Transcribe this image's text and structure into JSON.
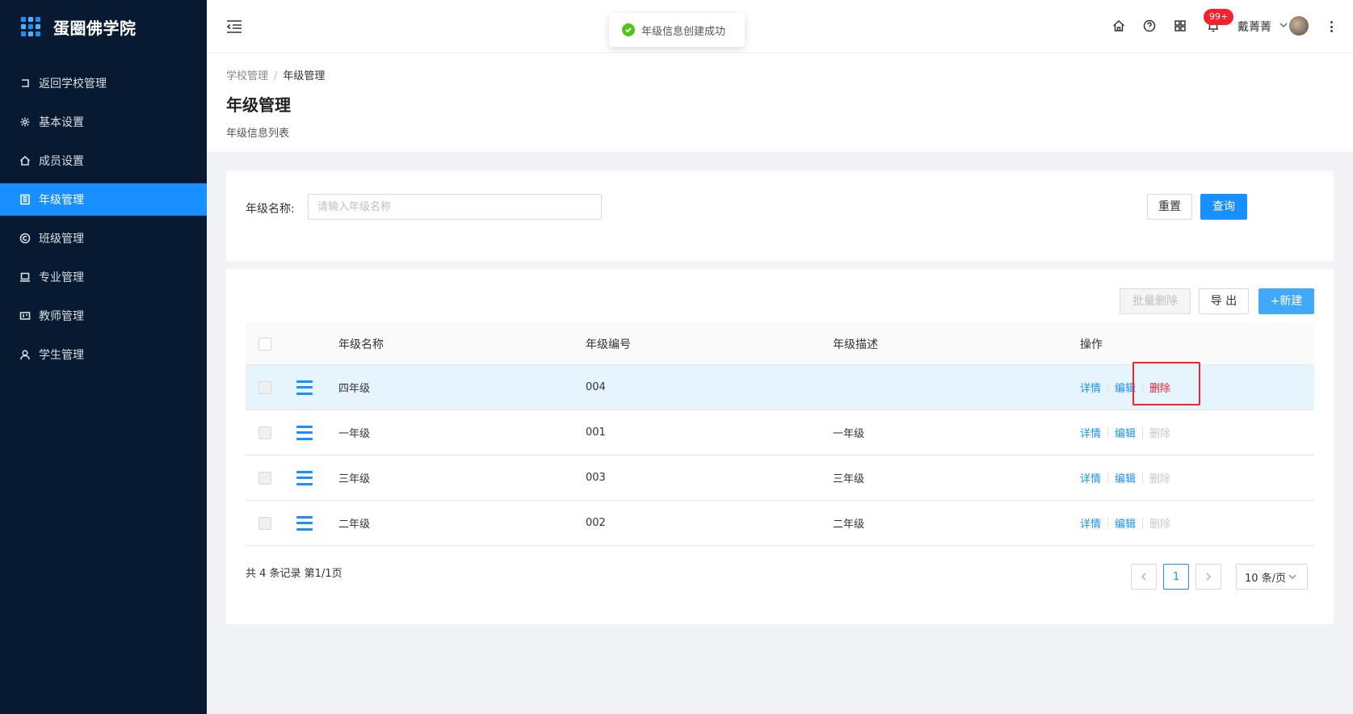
{
  "sidebar": {
    "logo_text": "蛋圈佛学院",
    "items": [
      {
        "label": "返回学校管理"
      },
      {
        "label": "基本设置"
      },
      {
        "label": "成员设置"
      },
      {
        "label": "年级管理"
      },
      {
        "label": "班级管理"
      },
      {
        "label": "专业管理"
      },
      {
        "label": "教师管理"
      },
      {
        "label": "学生管理"
      }
    ]
  },
  "header": {
    "toast": "年级信息创建成功",
    "badge": "99+",
    "user_name": "戴菁菁"
  },
  "page": {
    "breadcrumb": [
      "学校管理",
      "/",
      "年级管理"
    ],
    "title": "年级管理",
    "subtitle": "年级信息列表"
  },
  "search": {
    "label": "年级名称:",
    "placeholder": "请输入年级名称",
    "reset_label": "重置",
    "query_label": "查询"
  },
  "toolbar": {
    "batch_delete_label": "批量删除",
    "export_label": "导 出",
    "new_label": "+新建"
  },
  "table": {
    "columns": [
      "年级名称",
      "年级编号",
      "年级描述",
      "操作"
    ],
    "rows": [
      {
        "name": "四年级",
        "code": "004",
        "desc": "",
        "detail": "详情",
        "edit": "编辑",
        "delete": "删除"
      },
      {
        "name": "一年级",
        "code": "001",
        "desc": "一年级",
        "detail": "详情",
        "edit": "编辑",
        "delete": "删除"
      },
      {
        "name": "三年级",
        "code": "003",
        "desc": "三年级",
        "detail": "详情",
        "edit": "编辑",
        "delete": "删除"
      },
      {
        "name": "二年级",
        "code": "002",
        "desc": "二年级",
        "detail": "详情",
        "edit": "编辑",
        "delete": "删除"
      }
    ]
  },
  "pagination": {
    "total_text": "共 4 条记录 第1/1页",
    "current_page": "1",
    "page_size": "10 条/页"
  },
  "colors": {
    "primary": "#1890ff",
    "sidebar_bg": "#071a32",
    "danger": "#f5222d",
    "success": "#52c41a"
  }
}
